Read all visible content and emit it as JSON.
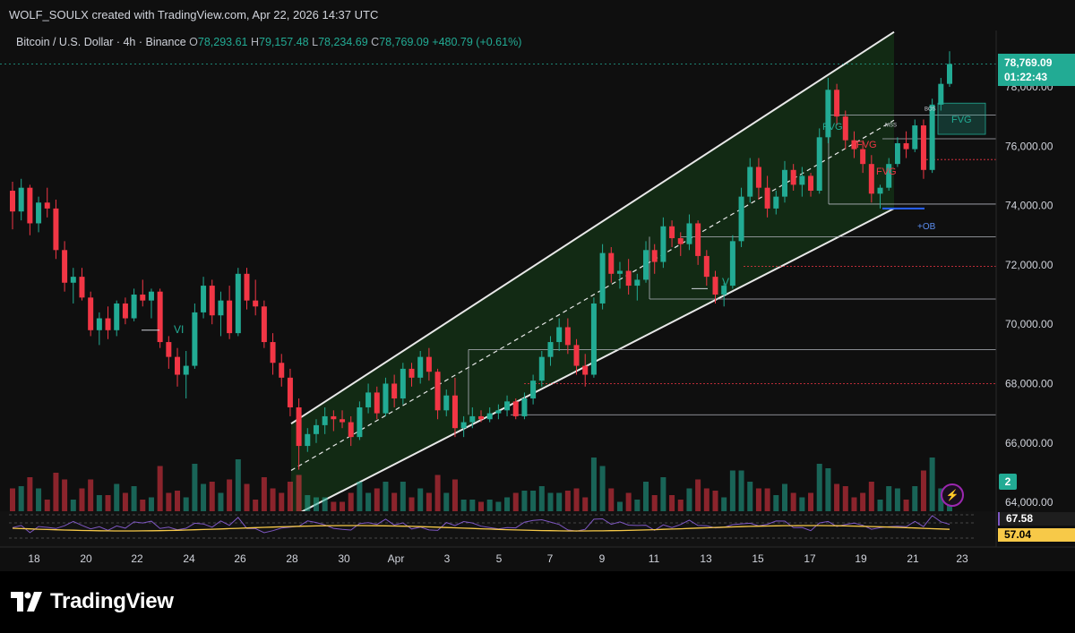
{
  "header": {
    "credit": "WOLF_SOULX created with TradingView.com, Apr 22, 2026 14:37 UTC"
  },
  "legend": {
    "symbol": "Bitcoin / U.S. Dollar · 4h · Binance",
    "open_label": "O",
    "open": "78,293.61",
    "high_label": "H",
    "high": "79,157.48",
    "low_label": "L",
    "low": "78,234.69",
    "close_label": "C",
    "close": "78,769.09",
    "change": "+480.79 (+0.61%)"
  },
  "price_tag": {
    "price": "78,769.09",
    "countdown": "01:22:43"
  },
  "rsi": {
    "value1": "67.58",
    "value2": "57.04"
  },
  "volume_badge": "2",
  "footer": {
    "brand": "TradingView"
  },
  "colors": {
    "up": "#22ab94",
    "down": "#f23645",
    "channel": "#1b5e20",
    "rsi": "#7e57c2",
    "rsi_ma": "#f7c948"
  },
  "chart_data": {
    "type": "candlestick",
    "x_ticks": [
      "18",
      "20",
      "22",
      "24",
      "26",
      "28",
      "30",
      "Apr",
      "3",
      "5",
      "7",
      "9",
      "11",
      "13",
      "15",
      "17",
      "19",
      "21",
      "23"
    ],
    "y_ticks": [
      "64,000.00",
      "66,000.00",
      "68,000.00",
      "70,000.00",
      "72,000.00",
      "74,000.00",
      "76,000.00",
      "78,000.00"
    ],
    "ylim": [
      63700,
      79900
    ],
    "annotations": {
      "vi": [
        "VI",
        "VI"
      ],
      "fvg": [
        "FVG",
        "FVG",
        "FVG"
      ],
      "ob": "+OB",
      "bos": "BOS",
      "mss": "MSS"
    },
    "series": [
      {
        "values": [
          [
            74500,
            74800,
            73200,
            73800
          ],
          [
            73800,
            74900,
            73500,
            74600
          ],
          [
            74600,
            74700,
            73000,
            73400
          ],
          [
            73400,
            74300,
            73100,
            74100
          ],
          [
            74100,
            74600,
            73600,
            73900
          ],
          [
            73900,
            74200,
            72200,
            72500
          ],
          [
            72500,
            72800,
            71100,
            71400
          ],
          [
            71400,
            71900,
            70700,
            71600
          ],
          [
            71600,
            71900,
            70800,
            70900
          ],
          [
            70900,
            71100,
            69600,
            69800
          ],
          [
            69800,
            70400,
            69300,
            70200
          ],
          [
            70200,
            70600,
            69500,
            69800
          ],
          [
            69800,
            70800,
            69600,
            70700
          ],
          [
            70700,
            70900,
            70000,
            70200
          ],
          [
            70200,
            71200,
            70100,
            71000
          ],
          [
            71000,
            71500,
            70600,
            70800
          ],
          [
            70800,
            71200,
            70200,
            71100
          ],
          [
            71100,
            71200,
            69200,
            69400
          ],
          [
            69400,
            69600,
            68500,
            68900
          ],
          [
            68900,
            69200,
            67900,
            68300
          ],
          [
            68300,
            69100,
            67500,
            68600
          ],
          [
            68600,
            70700,
            68500,
            70400
          ],
          [
            70400,
            71600,
            70200,
            71300
          ],
          [
            71300,
            71500,
            70000,
            70300
          ],
          [
            70300,
            71100,
            69600,
            70800
          ],
          [
            70800,
            71300,
            69500,
            69700
          ],
          [
            69700,
            71900,
            69600,
            71700
          ],
          [
            71700,
            71900,
            70500,
            70800
          ],
          [
            70800,
            71500,
            70300,
            70600
          ],
          [
            70600,
            70800,
            69200,
            69400
          ],
          [
            69400,
            69700,
            68300,
            68700
          ],
          [
            68700,
            69000,
            67900,
            68200
          ],
          [
            68200,
            68500,
            66900,
            67200
          ],
          [
            67200,
            67500,
            65100,
            65900
          ],
          [
            65900,
            66500,
            65700,
            66300
          ],
          [
            66300,
            66800,
            66000,
            66600
          ],
          [
            66600,
            67200,
            66300,
            66900
          ],
          [
            66900,
            67100,
            66400,
            66800
          ],
          [
            66800,
            67100,
            66500,
            66700
          ],
          [
            66700,
            66900,
            65900,
            66200
          ],
          [
            66200,
            67400,
            66100,
            67200
          ],
          [
            67200,
            68000,
            67000,
            67700
          ],
          [
            67700,
            67900,
            66800,
            67000
          ],
          [
            67000,
            68200,
            66900,
            68000
          ],
          [
            68000,
            68300,
            67200,
            67500
          ],
          [
            67500,
            68700,
            67300,
            68500
          ],
          [
            68500,
            68700,
            67900,
            68200
          ],
          [
            68200,
            69100,
            68000,
            68900
          ],
          [
            68900,
            69200,
            68100,
            68400
          ],
          [
            68400,
            68500,
            66800,
            67100
          ],
          [
            67100,
            67800,
            66900,
            67600
          ],
          [
            67600,
            68200,
            66200,
            66500
          ],
          [
            66500,
            66900,
            66200,
            66700
          ],
          [
            66700,
            67200,
            66500,
            66900
          ],
          [
            66900,
            67100,
            66700,
            66800
          ],
          [
            66800,
            67200,
            66700,
            67000
          ],
          [
            67000,
            67300,
            66800,
            67100
          ],
          [
            67100,
            67600,
            66900,
            67400
          ],
          [
            67400,
            67500,
            66800,
            66900
          ],
          [
            66900,
            67700,
            66800,
            67500
          ],
          [
            67500,
            68300,
            67300,
            68100
          ],
          [
            68100,
            69100,
            67900,
            68900
          ],
          [
            68900,
            69600,
            68600,
            69400
          ],
          [
            69400,
            70200,
            69100,
            69900
          ],
          [
            69900,
            70200,
            69000,
            69300
          ],
          [
            69300,
            69500,
            68300,
            68600
          ],
          [
            68600,
            69000,
            67900,
            68300
          ],
          [
            68300,
            70900,
            68200,
            70700
          ],
          [
            70700,
            72700,
            70500,
            72400
          ],
          [
            72400,
            72600,
            71400,
            71700
          ],
          [
            71700,
            72100,
            71200,
            71800
          ],
          [
            71800,
            72200,
            71000,
            71300
          ],
          [
            71300,
            71700,
            70800,
            71500
          ],
          [
            71500,
            72800,
            71400,
            72500
          ],
          [
            72500,
            72700,
            71700,
            72100
          ],
          [
            72100,
            73600,
            71900,
            73300
          ],
          [
            73300,
            73500,
            72600,
            72900
          ],
          [
            72900,
            73100,
            72300,
            72700
          ],
          [
            72700,
            73700,
            72500,
            73400
          ],
          [
            73400,
            73500,
            72000,
            72300
          ],
          [
            72300,
            72500,
            71300,
            71600
          ],
          [
            71600,
            71800,
            70700,
            71000
          ],
          [
            71000,
            71400,
            70600,
            71300
          ],
          [
            71300,
            73000,
            71200,
            72800
          ],
          [
            72800,
            74600,
            72600,
            74300
          ],
          [
            74300,
            75600,
            74100,
            75300
          ],
          [
            75300,
            75600,
            74200,
            74600
          ],
          [
            74600,
            75000,
            73600,
            73900
          ],
          [
            73900,
            74500,
            73700,
            74300
          ],
          [
            74300,
            75500,
            74100,
            75200
          ],
          [
            75200,
            75400,
            74500,
            74700
          ],
          [
            74700,
            75300,
            74300,
            75000
          ],
          [
            75000,
            75100,
            74300,
            74500
          ],
          [
            74500,
            76600,
            74400,
            76300
          ],
          [
            76300,
            78300,
            76100,
            77900
          ],
          [
            77900,
            78100,
            76700,
            77000
          ],
          [
            77000,
            77200,
            75900,
            76200
          ],
          [
            76200,
            76500,
            75600,
            75900
          ],
          [
            75900,
            76200,
            75100,
            75400
          ],
          [
            75400,
            75700,
            74100,
            74400
          ],
          [
            74400,
            74700,
            73900,
            74600
          ],
          [
            74600,
            75600,
            74500,
            75400
          ],
          [
            75400,
            76300,
            75300,
            76100
          ],
          [
            76100,
            76500,
            75600,
            75900
          ],
          [
            75900,
            76900,
            75800,
            76700
          ],
          [
            76700,
            76900,
            74900,
            75200
          ],
          [
            75200,
            77600,
            75100,
            77400
          ],
          [
            77400,
            78300,
            77200,
            78100
          ],
          [
            78100,
            79200,
            78000,
            78769
          ]
        ]
      }
    ]
  }
}
